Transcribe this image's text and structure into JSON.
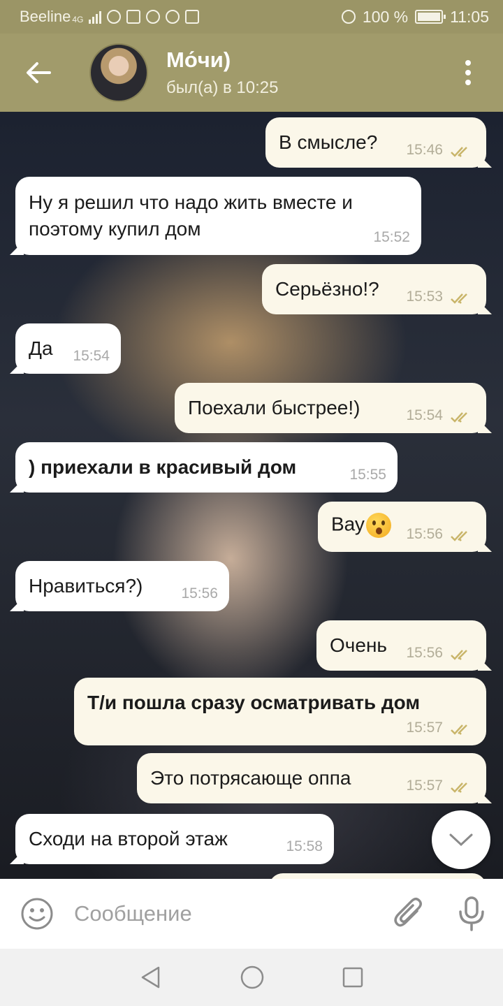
{
  "status_bar": {
    "carrier": "Beeline",
    "network": "4G",
    "battery": "100 %",
    "time": "11:05"
  },
  "header": {
    "name": "Мо́чи)",
    "status": "был(а) в 10:25"
  },
  "messages": [
    {
      "dir": "out",
      "text": "В смысле?",
      "time": "15:46"
    },
    {
      "dir": "in",
      "text": "Ну я решил что надо жить вместе и поэтому купил дом",
      "time": "15:52"
    },
    {
      "dir": "out",
      "text": "Серьёзно!?",
      "time": "15:53"
    },
    {
      "dir": "in",
      "text": "Да",
      "time": "15:54"
    },
    {
      "dir": "out",
      "text": "Поехали быстрее!)",
      "time": "15:54"
    },
    {
      "dir": "in",
      "text": ") приехали в красивый дом",
      "time": "15:55"
    },
    {
      "dir": "out",
      "text": "Вау",
      "time": "15:56",
      "emoji": "hushed-face-emoji"
    },
    {
      "dir": "in",
      "text": "Нравиться?)",
      "time": "15:56"
    },
    {
      "dir": "out",
      "text": "Очень",
      "time": "15:56"
    },
    {
      "dir": "out",
      "text": "Т/и пошла сразу осматривать дом",
      "time": "15:57"
    },
    {
      "dir": "out",
      "text": "Это потрясающе оппа",
      "time": "15:57"
    },
    {
      "dir": "in",
      "text": "Сходи на второй этаж",
      "time": "15:58"
    }
  ],
  "input": {
    "placeholder": "Сообщение"
  },
  "colors": {
    "header": "#a19b6b",
    "status_bar": "#9b9566",
    "outgoing_bubble": "#fbf7e9",
    "incoming_bubble": "#ffffff",
    "read_ticks": "#c9b56a"
  },
  "icons": [
    "back-arrow-icon",
    "more-vert-icon",
    "chevron-down-icon",
    "emoji-icon",
    "attach-icon",
    "mic-icon",
    "nav-back-icon",
    "nav-home-icon",
    "nav-recents-icon"
  ]
}
